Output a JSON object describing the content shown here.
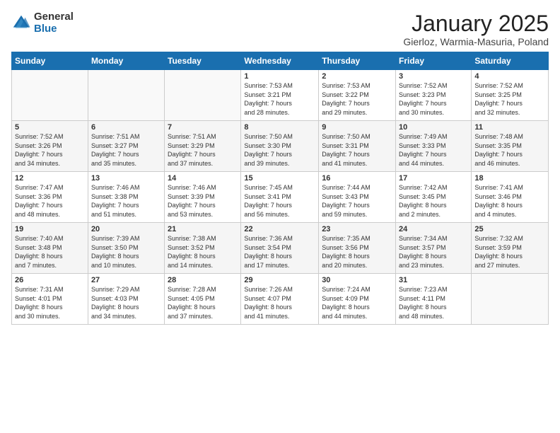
{
  "header": {
    "logo_general": "General",
    "logo_blue": "Blue",
    "title": "January 2025",
    "location": "Gierloz, Warmia-Masuria, Poland"
  },
  "weekdays": [
    "Sunday",
    "Monday",
    "Tuesday",
    "Wednesday",
    "Thursday",
    "Friday",
    "Saturday"
  ],
  "weeks": [
    [
      {
        "day": "",
        "info": ""
      },
      {
        "day": "",
        "info": ""
      },
      {
        "day": "",
        "info": ""
      },
      {
        "day": "1",
        "info": "Sunrise: 7:53 AM\nSunset: 3:21 PM\nDaylight: 7 hours\nand 28 minutes."
      },
      {
        "day": "2",
        "info": "Sunrise: 7:53 AM\nSunset: 3:22 PM\nDaylight: 7 hours\nand 29 minutes."
      },
      {
        "day": "3",
        "info": "Sunrise: 7:52 AM\nSunset: 3:23 PM\nDaylight: 7 hours\nand 30 minutes."
      },
      {
        "day": "4",
        "info": "Sunrise: 7:52 AM\nSunset: 3:25 PM\nDaylight: 7 hours\nand 32 minutes."
      }
    ],
    [
      {
        "day": "5",
        "info": "Sunrise: 7:52 AM\nSunset: 3:26 PM\nDaylight: 7 hours\nand 34 minutes."
      },
      {
        "day": "6",
        "info": "Sunrise: 7:51 AM\nSunset: 3:27 PM\nDaylight: 7 hours\nand 35 minutes."
      },
      {
        "day": "7",
        "info": "Sunrise: 7:51 AM\nSunset: 3:29 PM\nDaylight: 7 hours\nand 37 minutes."
      },
      {
        "day": "8",
        "info": "Sunrise: 7:50 AM\nSunset: 3:30 PM\nDaylight: 7 hours\nand 39 minutes."
      },
      {
        "day": "9",
        "info": "Sunrise: 7:50 AM\nSunset: 3:31 PM\nDaylight: 7 hours\nand 41 minutes."
      },
      {
        "day": "10",
        "info": "Sunrise: 7:49 AM\nSunset: 3:33 PM\nDaylight: 7 hours\nand 44 minutes."
      },
      {
        "day": "11",
        "info": "Sunrise: 7:48 AM\nSunset: 3:35 PM\nDaylight: 7 hours\nand 46 minutes."
      }
    ],
    [
      {
        "day": "12",
        "info": "Sunrise: 7:47 AM\nSunset: 3:36 PM\nDaylight: 7 hours\nand 48 minutes."
      },
      {
        "day": "13",
        "info": "Sunrise: 7:46 AM\nSunset: 3:38 PM\nDaylight: 7 hours\nand 51 minutes."
      },
      {
        "day": "14",
        "info": "Sunrise: 7:46 AM\nSunset: 3:39 PM\nDaylight: 7 hours\nand 53 minutes."
      },
      {
        "day": "15",
        "info": "Sunrise: 7:45 AM\nSunset: 3:41 PM\nDaylight: 7 hours\nand 56 minutes."
      },
      {
        "day": "16",
        "info": "Sunrise: 7:44 AM\nSunset: 3:43 PM\nDaylight: 7 hours\nand 59 minutes."
      },
      {
        "day": "17",
        "info": "Sunrise: 7:42 AM\nSunset: 3:45 PM\nDaylight: 8 hours\nand 2 minutes."
      },
      {
        "day": "18",
        "info": "Sunrise: 7:41 AM\nSunset: 3:46 PM\nDaylight: 8 hours\nand 4 minutes."
      }
    ],
    [
      {
        "day": "19",
        "info": "Sunrise: 7:40 AM\nSunset: 3:48 PM\nDaylight: 8 hours\nand 7 minutes."
      },
      {
        "day": "20",
        "info": "Sunrise: 7:39 AM\nSunset: 3:50 PM\nDaylight: 8 hours\nand 10 minutes."
      },
      {
        "day": "21",
        "info": "Sunrise: 7:38 AM\nSunset: 3:52 PM\nDaylight: 8 hours\nand 14 minutes."
      },
      {
        "day": "22",
        "info": "Sunrise: 7:36 AM\nSunset: 3:54 PM\nDaylight: 8 hours\nand 17 minutes."
      },
      {
        "day": "23",
        "info": "Sunrise: 7:35 AM\nSunset: 3:56 PM\nDaylight: 8 hours\nand 20 minutes."
      },
      {
        "day": "24",
        "info": "Sunrise: 7:34 AM\nSunset: 3:57 PM\nDaylight: 8 hours\nand 23 minutes."
      },
      {
        "day": "25",
        "info": "Sunrise: 7:32 AM\nSunset: 3:59 PM\nDaylight: 8 hours\nand 27 minutes."
      }
    ],
    [
      {
        "day": "26",
        "info": "Sunrise: 7:31 AM\nSunset: 4:01 PM\nDaylight: 8 hours\nand 30 minutes."
      },
      {
        "day": "27",
        "info": "Sunrise: 7:29 AM\nSunset: 4:03 PM\nDaylight: 8 hours\nand 34 minutes."
      },
      {
        "day": "28",
        "info": "Sunrise: 7:28 AM\nSunset: 4:05 PM\nDaylight: 8 hours\nand 37 minutes."
      },
      {
        "day": "29",
        "info": "Sunrise: 7:26 AM\nSunset: 4:07 PM\nDaylight: 8 hours\nand 41 minutes."
      },
      {
        "day": "30",
        "info": "Sunrise: 7:24 AM\nSunset: 4:09 PM\nDaylight: 8 hours\nand 44 minutes."
      },
      {
        "day": "31",
        "info": "Sunrise: 7:23 AM\nSunset: 4:11 PM\nDaylight: 8 hours\nand 48 minutes."
      },
      {
        "day": "",
        "info": ""
      }
    ]
  ]
}
